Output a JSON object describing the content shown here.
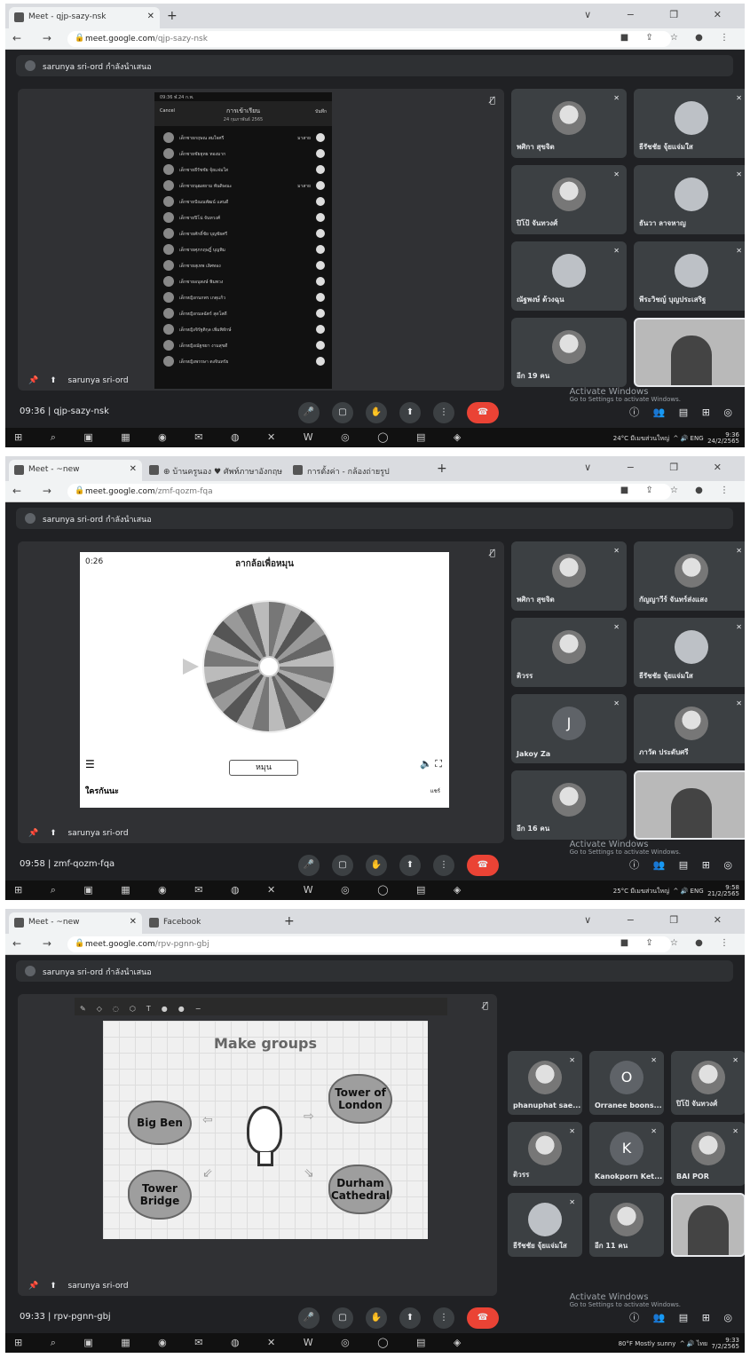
{
  "common": {
    "presenter_banner": "sarunya sri-ord กำลังนำเสนอ",
    "presenter_dot_letter": "s",
    "presenter_name": "sarunya sri-ord",
    "activate_title": "Activate Windows",
    "activate_sub": "Go to Settings to activate Windows.",
    "nav_buttons": "← → C",
    "addr_icons": "■ ⇪ ☆ ● ⋮",
    "window_controls": "∨ − ❐ ✕",
    "taskbar_icons": "⊞ ⌕ ▣ ▦ ◉ ✉ ◍ ✕ W ◎ ◯ ▤ ◈",
    "side_icons": "ⓘ 👥 ▤ ⊞ ◎",
    "controls": [
      "🎤",
      "▢",
      "✋",
      "⬆",
      "⋮",
      "☎"
    ]
  },
  "shot1": {
    "tabs": [
      {
        "label": "Meet - qjp-sazy-nsk",
        "active": true
      }
    ],
    "url_host": "meet.google.com",
    "url_path": "/qjp-sazy-nsk",
    "meeting_info": "09:36  |  qjp-sazy-nsk",
    "phone": {
      "status": "09:36  ฬ.24 ก.พ.",
      "cancel": "Cancel",
      "title": "การเข้าเรียน",
      "date": "24 กุมภาพันธ์ 2565",
      "save": "บันทึก",
      "rows": [
        {
          "name": "เด็กชายกฤษณ สมใจศรี",
          "tag": "มาสาย"
        },
        {
          "name": "เด็กชายชัยยุทธ ทองมาก",
          "tag": ""
        },
        {
          "name": "เด็กชายธีรัชชัย จุ้ยแจ่มใส",
          "tag": ""
        },
        {
          "name": "เด็กชายนุฒสยาม พันดิษณะ",
          "tag": "มาสาย"
        },
        {
          "name": "เด็กชายปัณณพัฒน์ แสนดี",
          "tag": ""
        },
        {
          "name": "เด็กชายปิโน่ จันทวงศ์",
          "tag": ""
        },
        {
          "name": "เด็กชายศักดิ์ชัย บุญชัยศรี",
          "tag": ""
        },
        {
          "name": "เด็กชายศุภกฤษฎิ์ บุญพิม",
          "tag": ""
        },
        {
          "name": "เด็กชายสุเทพ เลิศทอง",
          "tag": ""
        },
        {
          "name": "เด็กชายอนุพงษ์ พิมพวง",
          "tag": ""
        },
        {
          "name": "เด็กหญิงกนกพร เกตุแก้ว",
          "tag": ""
        },
        {
          "name": "เด็กหญิงกมลฉัตร์ สุดโสดี",
          "tag": ""
        },
        {
          "name": "เด็กหญิงจิรัฐติกุล เพิ่มพิทักษ์",
          "tag": ""
        },
        {
          "name": "เด็กหญิงณัฐชยา งามสุขดี",
          "tag": ""
        },
        {
          "name": "เด็กหญิงพรรษา ตงจินทรัย",
          "tag": ""
        }
      ]
    },
    "tiles": [
      {
        "name": "พศิกา สุขจิต",
        "kind": "photo"
      },
      {
        "name": "ธีรัชชัย จุ้ยแจ่มใส",
        "kind": "avatar"
      },
      {
        "name": "ปิโป้ จันทวงศ์",
        "kind": "photo"
      },
      {
        "name": "ธันวา ลาจหาญ",
        "kind": "avatar"
      },
      {
        "name": "ณัฐพงษ์ ด้วงฉุน",
        "kind": "avatar"
      },
      {
        "name": "พีระวิชญ์ บุญประเสริฐ",
        "kind": "avatar"
      },
      {
        "name": "อีก 19 คน",
        "kind": "more"
      },
      {
        "name": "",
        "kind": "video"
      }
    ],
    "clock_time": "9:36",
    "clock_date": "24/2/2565",
    "weather": "24°C มีเมฆส่วนใหญ่",
    "lang": "ENG"
  },
  "shot2": {
    "tabs": [
      {
        "label": "Meet - ~new",
        "active": true
      },
      {
        "label": "⊕ บ้านครูนอง ♥ ศัพท์ภาษาอังกฤษ",
        "active": false
      },
      {
        "label": "การตั้งค่า - กล้องถ่ายรูป",
        "active": false
      }
    ],
    "url_host": "meet.google.com",
    "url_path": "/zmf-qozm-fqa",
    "meeting_info": "09:58  |  zmf-qozm-fqa",
    "wheel": {
      "timer": "0:26",
      "title": "ลากล้อเพื่อหมุน",
      "spin": "หมุน",
      "footer": "ใครกันนะ",
      "share": "แชร์",
      "numbers": [
        "1",
        "2",
        "3",
        "4",
        "5",
        "6",
        "7",
        "8",
        "9",
        "10",
        "11",
        "12",
        "13",
        "14",
        "15",
        "16",
        "17",
        "18",
        "19",
        "20",
        "21",
        "22",
        "23",
        "24",
        "25",
        "26"
      ]
    },
    "tiles": [
      {
        "name": "พศิกา สุขจิต",
        "kind": "photo"
      },
      {
        "name": "กัญญาวีร์ จันทร์ส่งแสง",
        "kind": "photo"
      },
      {
        "name": "ติวรร",
        "kind": "photo"
      },
      {
        "name": "ธีรัชชัย จุ้ยแจ่มใส",
        "kind": "avatar"
      },
      {
        "name": "Jakoy Za",
        "kind": "letter",
        "letter": "J"
      },
      {
        "name": "ภาวัต ประดับศรี",
        "kind": "photo"
      },
      {
        "name": "อีก 16 คน",
        "kind": "more"
      },
      {
        "name": "",
        "kind": "video"
      }
    ],
    "clock_time": "9:58",
    "clock_date": "21/2/2565",
    "weather": "25°C มีเมฆส่วนใหญ่",
    "lang": "ENG"
  },
  "shot3": {
    "tabs": [
      {
        "label": "Meet - ~new",
        "active": true
      },
      {
        "label": "Facebook",
        "active": false
      }
    ],
    "url_host": "meet.google.com",
    "url_path": "/rpv-pgnn-gbj",
    "meeting_info": "09:33  |  rpv-pgnn-gbj",
    "board": {
      "title": "Make groups",
      "items": [
        "Big Ben",
        "Tower Bridge",
        "Tower of London",
        "Durham Cathedral"
      ]
    },
    "tiles": [
      {
        "name": "phanuphat sae...",
        "kind": "photo"
      },
      {
        "name": "Orranee boons...",
        "kind": "letter",
        "letter": "O"
      },
      {
        "name": "ปิโป้ จันทวงศ์",
        "kind": "photo"
      },
      {
        "name": "ติวรร",
        "kind": "photo"
      },
      {
        "name": "Kanokporn Ket...",
        "kind": "letter",
        "letter": "K"
      },
      {
        "name": "BAI POR",
        "kind": "photo"
      },
      {
        "name": "ธีรัชชัย จุ้ยแจ่มใส",
        "kind": "avatar"
      },
      {
        "name": "อีก 11 คน",
        "kind": "more"
      },
      {
        "name": "",
        "kind": "video"
      }
    ],
    "clock_time": "9:33",
    "clock_date": "7/2/2565",
    "weather": "80°F Mostly sunny",
    "lang": "ไทย"
  }
}
